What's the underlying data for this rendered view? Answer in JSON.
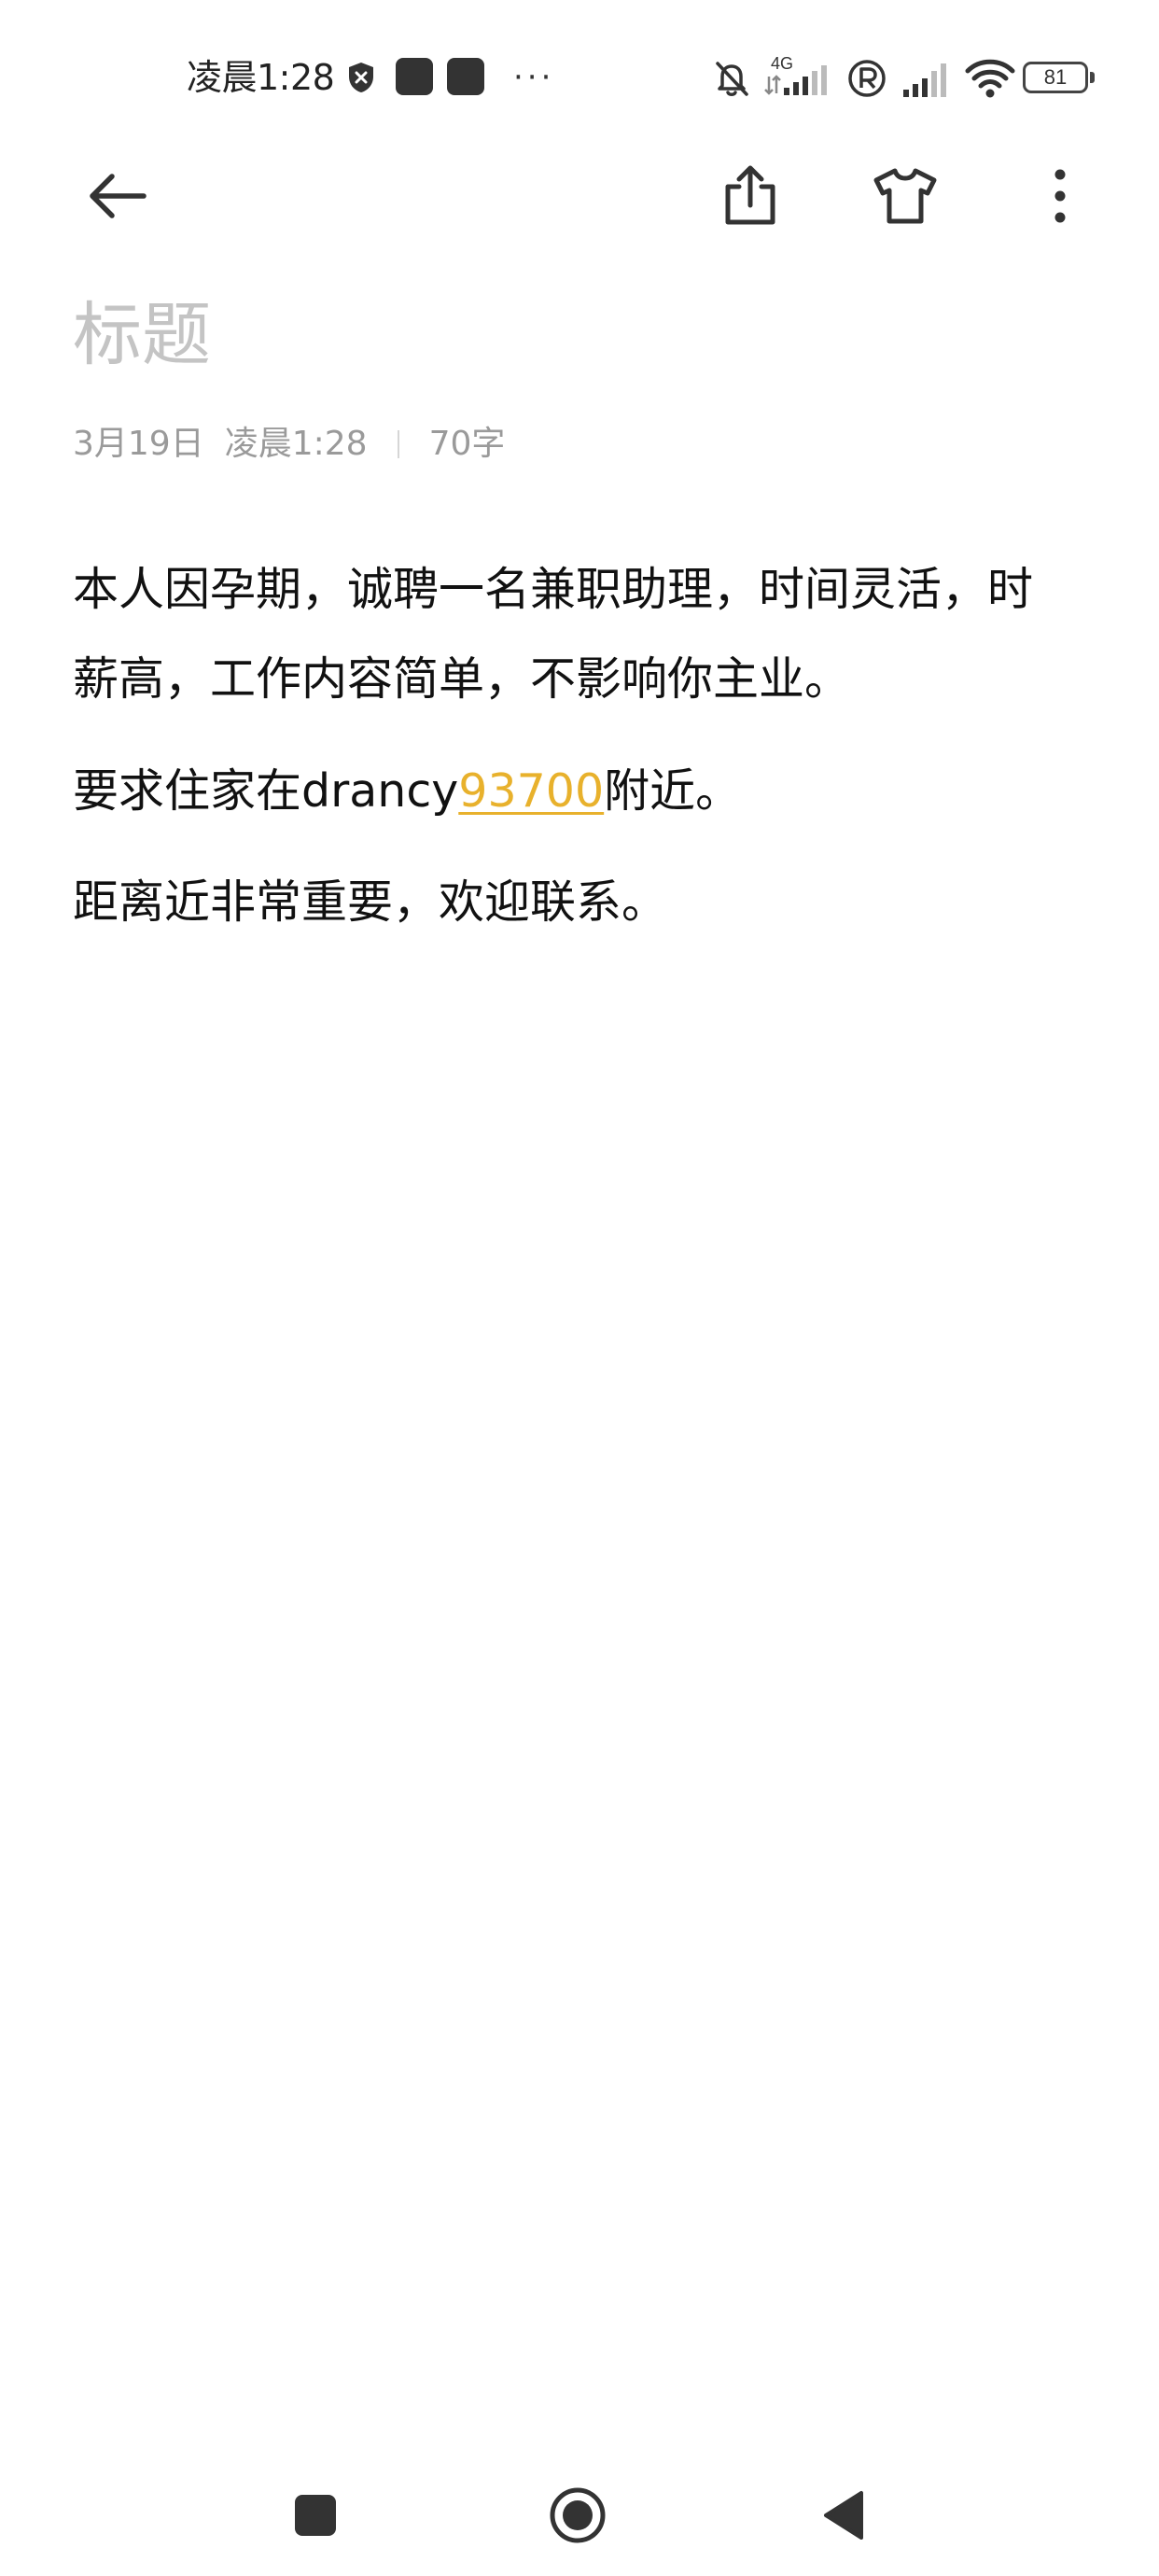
{
  "status_bar": {
    "time": "凌晨1:28",
    "more": "···",
    "network_label": "4G",
    "battery": "81",
    "icons": [
      "shield-icon",
      "app-notification-icon",
      "app-notification-icon",
      "mute-bell-icon",
      "signal-4g-icon",
      "roaming-r-icon",
      "signal-icon",
      "wifi-icon",
      "battery-icon"
    ]
  },
  "toolbar": {
    "icons": [
      "back-arrow-icon",
      "share-icon",
      "tshirt-theme-icon",
      "more-vertical-icon"
    ]
  },
  "note": {
    "title_placeholder": "标题",
    "date": "3月19日",
    "time": "凌晨1:28",
    "word_count": "70字",
    "paragraphs": {
      "p1_line1": "本人因孕期，诚聘一名兼职助理，时间灵活，时",
      "p1_line2": "薪高，工作内容简单，不影响你主业。",
      "p2_before": "要求住家在drancy",
      "p2_link": "93700",
      "p2_after": "附近。",
      "p3": "距离近非常重要，欢迎联系。"
    }
  },
  "colors": {
    "link": "#e8b12c",
    "placeholder": "#c4c4c4",
    "meta": "#9a9a9a",
    "text": "#111111"
  },
  "nav_bar": {
    "icons": [
      "recents-square-icon",
      "home-circle-icon",
      "back-triangle-icon"
    ]
  }
}
